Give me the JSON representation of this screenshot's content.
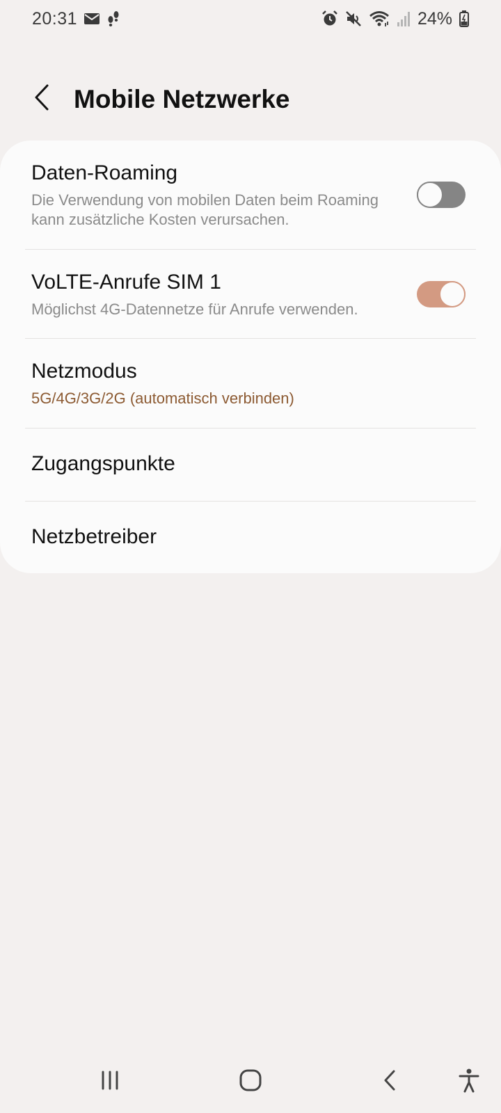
{
  "status_bar": {
    "time": "20:31",
    "battery_percent": "24%",
    "icons_left": [
      "mail-icon",
      "footsteps-icon"
    ],
    "icons_right": [
      "alarm-icon",
      "mute-icon",
      "wifi-icon",
      "signal-icon",
      "battery-icon"
    ]
  },
  "header": {
    "title": "Mobile Netzwerke"
  },
  "settings": {
    "items": [
      {
        "title": "Daten-Roaming",
        "subtitle": "Die Verwendung von mobilen Daten beim Roaming kann zusätzliche Kosten verursachen.",
        "toggle": false
      },
      {
        "title": "VoLTE-Anrufe SIM 1",
        "subtitle": "Möglichst 4G-Datennetze für Anrufe verwenden.",
        "toggle": true
      },
      {
        "title": "Netzmodus",
        "subtitle": "5G/4G/3G/2G (automatisch verbinden)"
      },
      {
        "title": "Zugangspunkte"
      },
      {
        "title": "Netzbetreiber"
      }
    ]
  },
  "navigation_bar": {
    "buttons": [
      "recent-apps-icon",
      "home-icon",
      "back-icon",
      "accessibility-icon"
    ]
  },
  "colors": {
    "background": "#f3f0ef",
    "card": "#fbfbfb",
    "accent_text": "#8c5a32",
    "toggle_on": "#d39a82",
    "toggle_off": "#858585"
  }
}
